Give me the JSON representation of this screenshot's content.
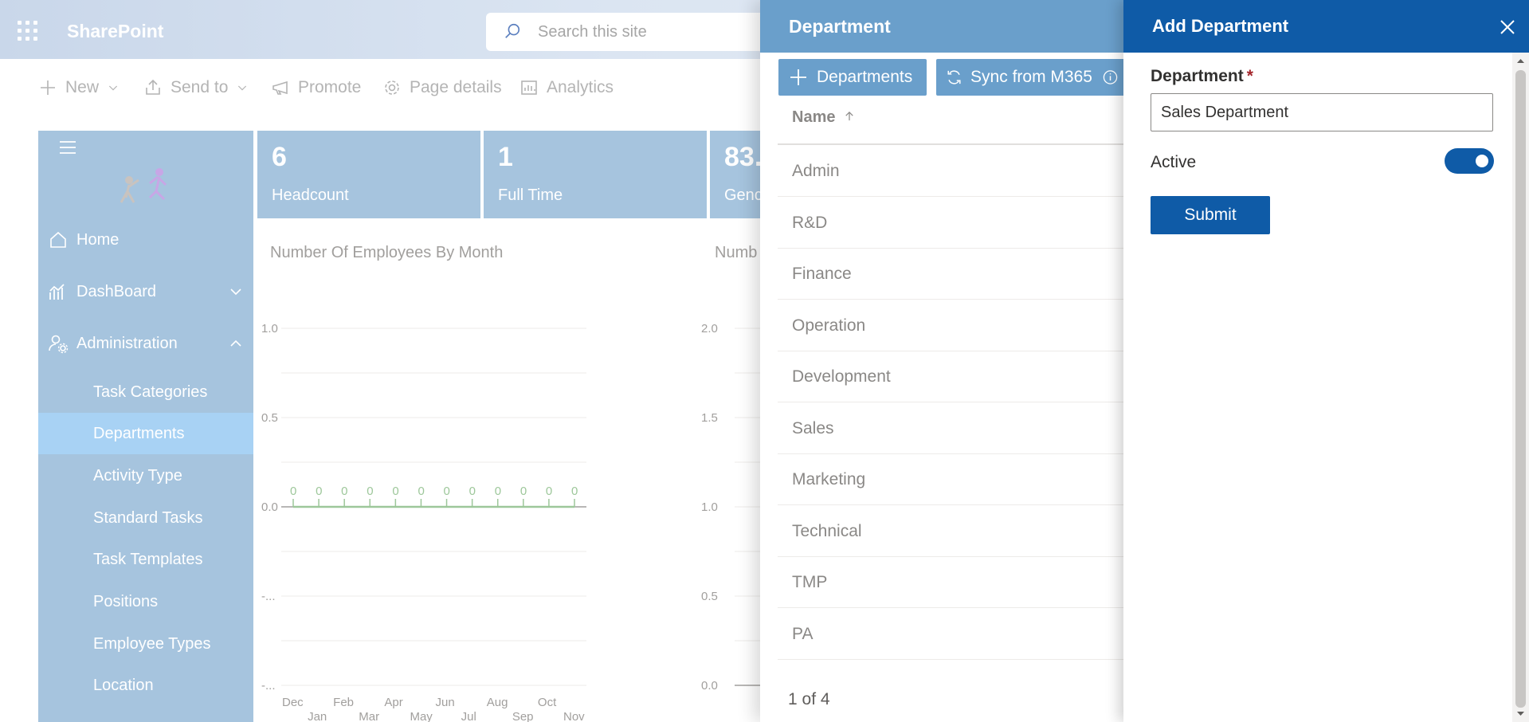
{
  "app": {
    "title": "SharePoint"
  },
  "search": {
    "placeholder": "Search this site"
  },
  "commandbar": {
    "new": "New",
    "send_to": "Send to",
    "promote": "Promote",
    "page_details": "Page details",
    "analytics": "Analytics"
  },
  "nav": {
    "home": "Home",
    "dashboard": "DashBoard",
    "administration": "Administration",
    "sub": [
      "Task Categories",
      "Departments",
      "Activity Type",
      "Standard Tasks",
      "Task Templates",
      "Positions",
      "Employee Types",
      "Location"
    ],
    "active_index": 1
  },
  "kpis": [
    {
      "value": "6",
      "label": "Headcount"
    },
    {
      "value": "1",
      "label": "Full Time"
    },
    {
      "value": "83.",
      "label": "Genc"
    }
  ],
  "charts": {
    "left_title": "Number Of Employees By Month",
    "right_title": "Numb"
  },
  "chart_data": [
    {
      "type": "line",
      "title": "Number Of Employees By Month",
      "x": [
        "Dec",
        "Jan",
        "Feb",
        "Mar",
        "Apr",
        "May",
        "Jun",
        "Jul",
        "Aug",
        "Sep",
        "Oct",
        "Nov"
      ],
      "series": [
        {
          "values": [
            0,
            0,
            0,
            0,
            0,
            0,
            0,
            0,
            0,
            0,
            0,
            0
          ]
        }
      ],
      "data_labels": [
        "0",
        "0",
        "0",
        "0",
        "0",
        "0",
        "0",
        "0",
        "0",
        "0",
        "0",
        "0"
      ],
      "y_ticks": [
        "1.0",
        "0.5",
        "0.0",
        "-...",
        "-..."
      ],
      "ylim": [
        -1.0,
        1.0
      ],
      "grid": true,
      "color": "#9dc79a"
    },
    {
      "type": "line",
      "title": "Numb",
      "y_ticks": [
        "2.0",
        "1.5",
        "1.0",
        "0.5",
        "0.0"
      ],
      "ylim": [
        0,
        2.0
      ],
      "grid": true
    }
  ],
  "department_panel": {
    "title": "Department",
    "add_button": "Departments",
    "sync_button": "Sync from M365",
    "column": "Name",
    "rows": [
      "Admin",
      "R&D",
      "Finance",
      "Operation",
      "Development",
      "Sales",
      "Marketing",
      "Technical",
      "TMP",
      "PA"
    ],
    "pager": "1 of 4"
  },
  "add_panel": {
    "title": "Add Department",
    "department_label": "Department",
    "required_mark": "*",
    "department_value": "Sales Department",
    "active_label": "Active",
    "active_on": true,
    "submit": "Submit"
  },
  "colors": {
    "primary": "#0f5ba7",
    "panel_header": "#6a9fcb",
    "nav_bg": "#a6c4de",
    "nav_active": "#a8d2f4"
  }
}
